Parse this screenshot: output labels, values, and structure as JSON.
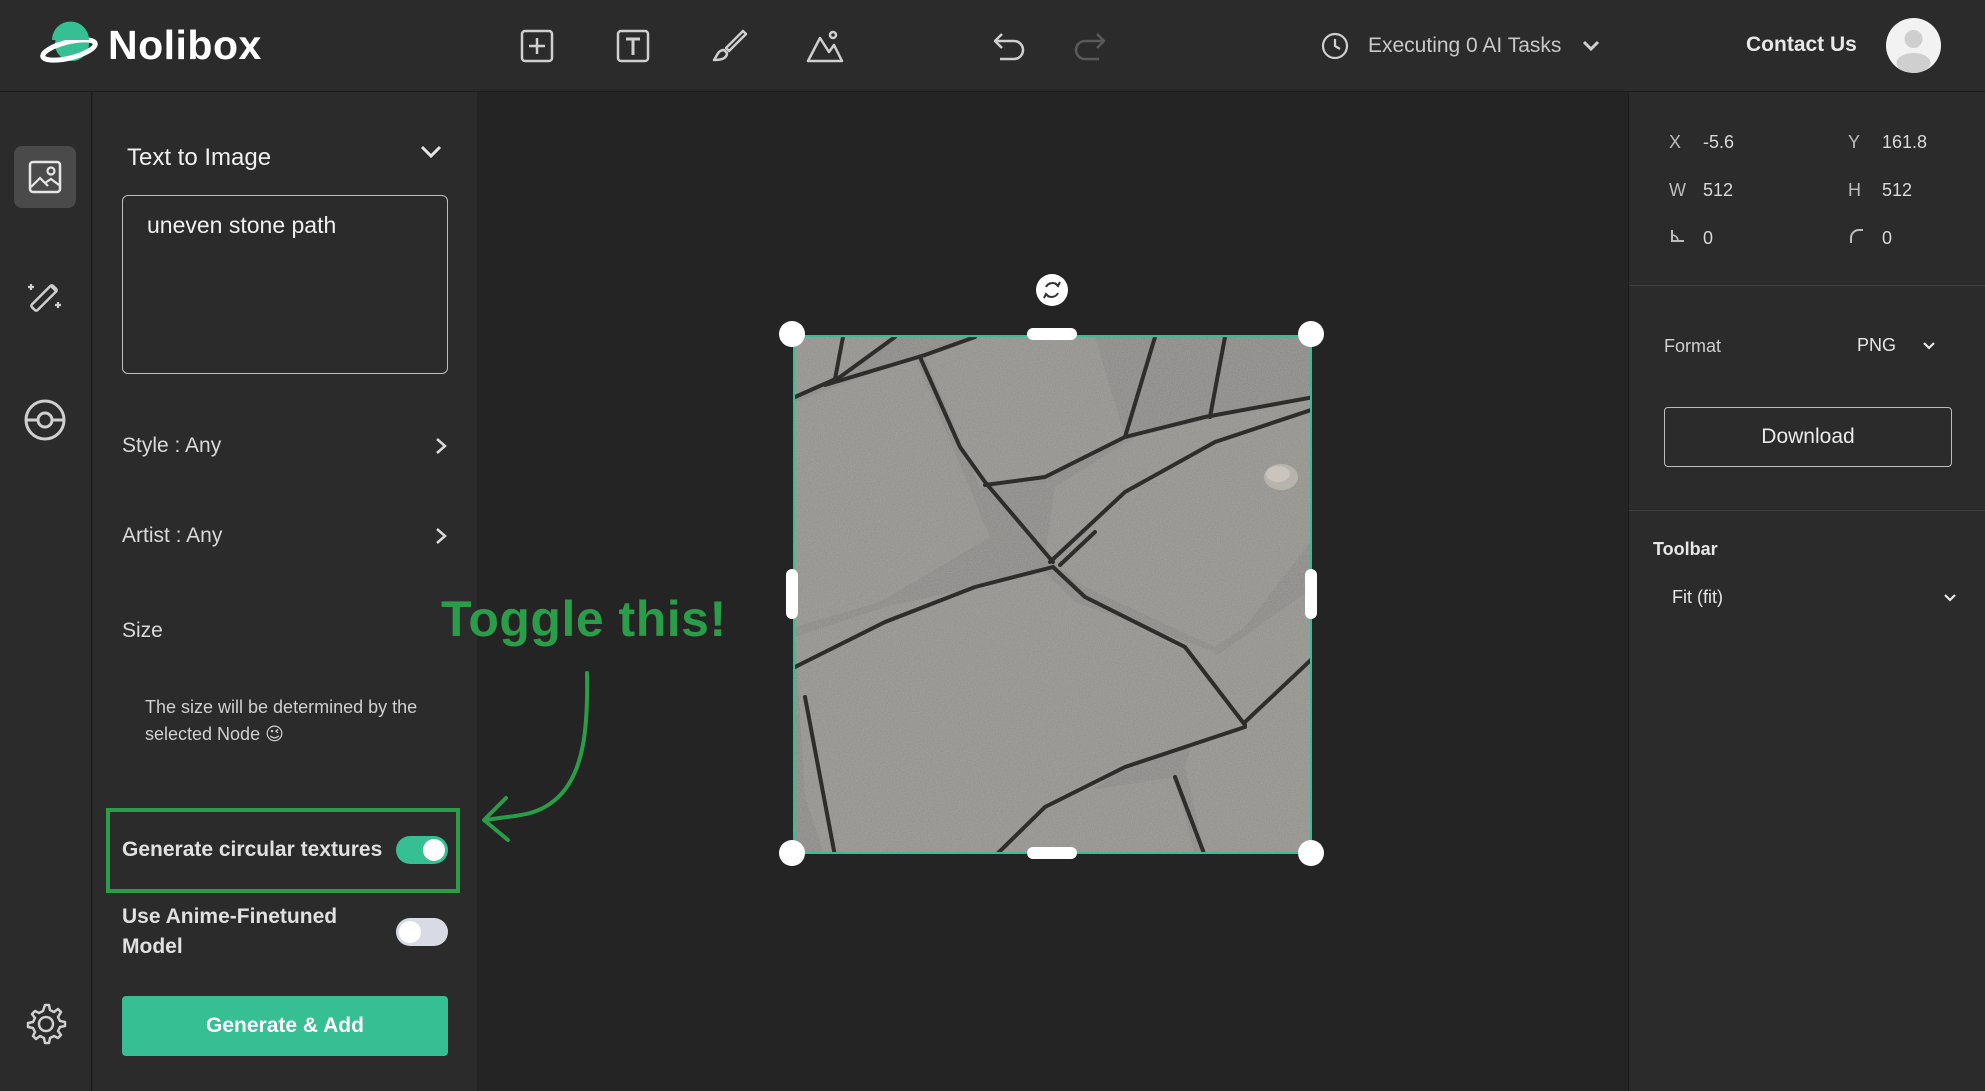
{
  "app": {
    "name": "Nolibox"
  },
  "header": {
    "tasks_label": "Executing 0 AI Tasks",
    "contact_label": "Contact Us"
  },
  "left_panel": {
    "mode_title": "Text to Image",
    "prompt_value": "uneven stone path",
    "style_label": "Style : Any",
    "artist_label": "Artist : Any",
    "size_label": "Size",
    "size_note": "The size will be determined by the selected Node 😉",
    "circular_label": "Generate circular textures",
    "circular_on": true,
    "anime_label": "Use Anime-Finetuned Model",
    "anime_on": false,
    "generate_label": "Generate & Add"
  },
  "annotation": {
    "text": "Toggle this!",
    "color": "#2a9d49"
  },
  "properties": {
    "x_key": "X",
    "x_val": "-5.6",
    "y_key": "Y",
    "y_val": "161.8",
    "w_key": "W",
    "w_val": "512",
    "h_key": "H",
    "h_val": "512",
    "skew_val": "0",
    "radius_val": "0"
  },
  "export": {
    "format_label": "Format",
    "format_value": "PNG",
    "download_label": "Download"
  },
  "toolbar": {
    "label": "Toolbar",
    "fit_value": "Fit (fit)"
  },
  "colors": {
    "accent": "#35bf93",
    "annotation": "#2a9d49",
    "bg": "#242424",
    "panel": "#2b2b2b"
  }
}
